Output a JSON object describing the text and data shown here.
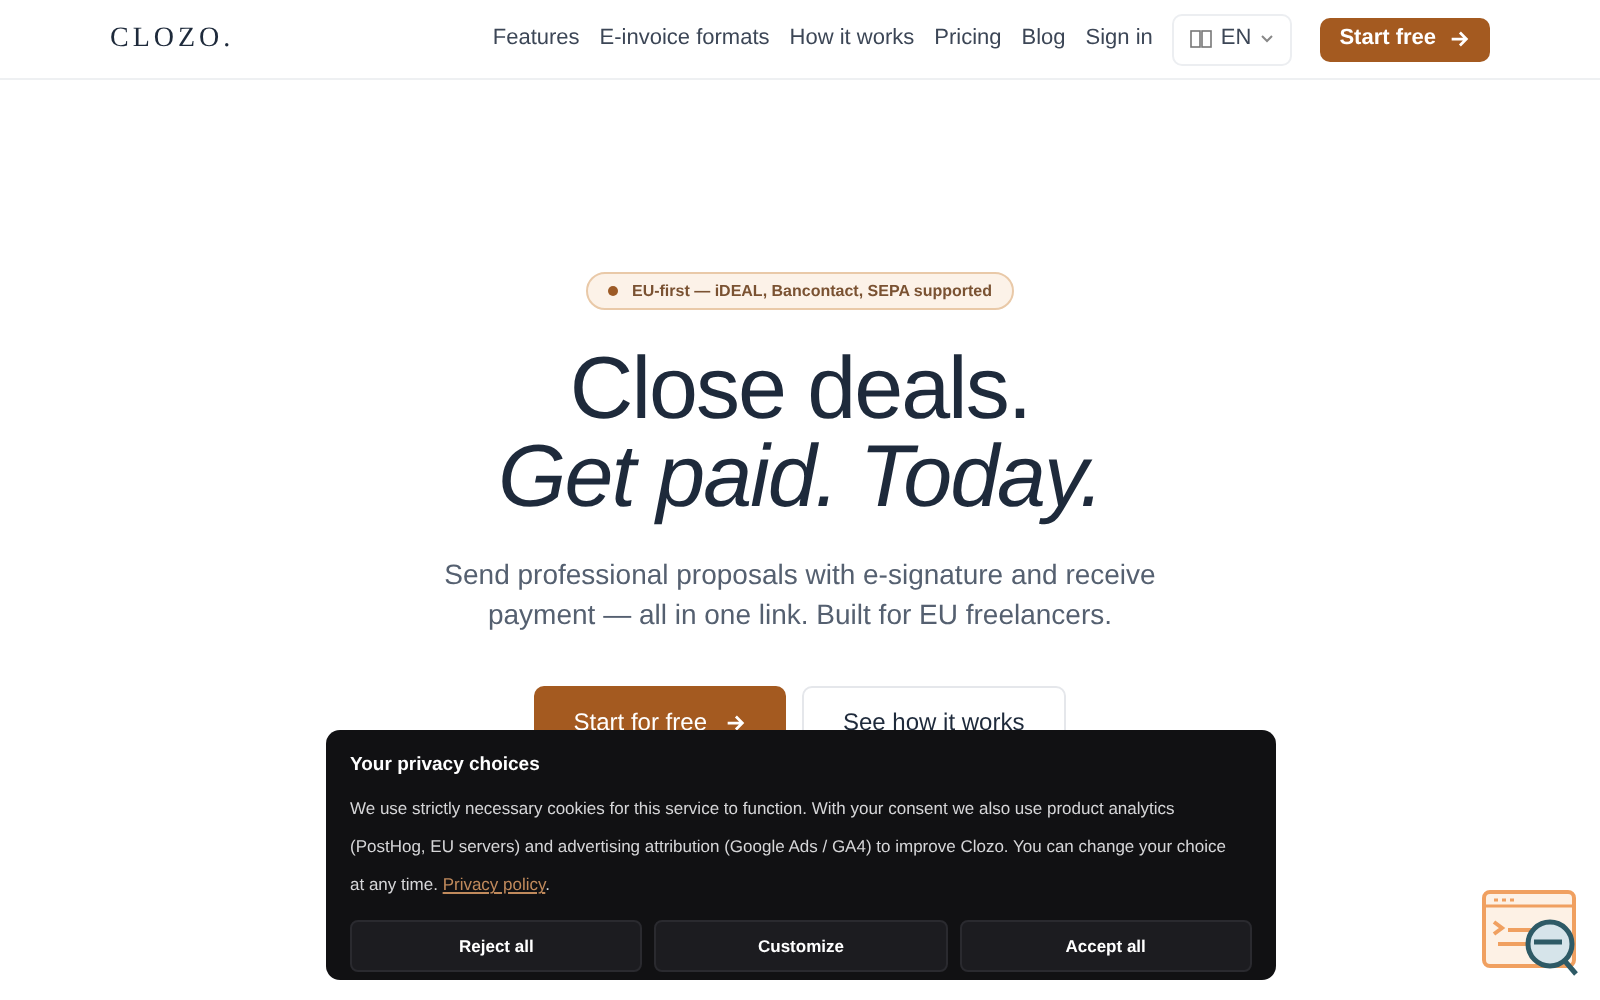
{
  "nav": {
    "logo": "CLOZO.",
    "links": [
      "Features",
      "E-invoice formats",
      "How it works",
      "Pricing",
      "Blog",
      "Sign in"
    ],
    "language": "EN",
    "cta": "Start free"
  },
  "hero": {
    "badge": "EU-first — iDEAL, Bancontact, SEPA supported",
    "title_line_1": "Close deals.",
    "title_line_2": "Get paid. Today.",
    "subtitle": "Send professional proposals with e-signature and receive payment — all in one link. Built for EU freelancers.",
    "primary_button": "Start for free",
    "secondary_button": "See how it works"
  },
  "cookie_banner": {
    "title": "Your privacy choices",
    "text": "We use strictly necessary cookies for this service to function. With your consent we also use product analytics (PostHog, EU servers) and advertising attribution (Google Ads / GA4) to improve Clozo. You can change your choice at any time.",
    "link": "Privacy policy",
    "end": ".",
    "buttons": [
      "Reject all",
      "Customize",
      "Accept all"
    ]
  }
}
